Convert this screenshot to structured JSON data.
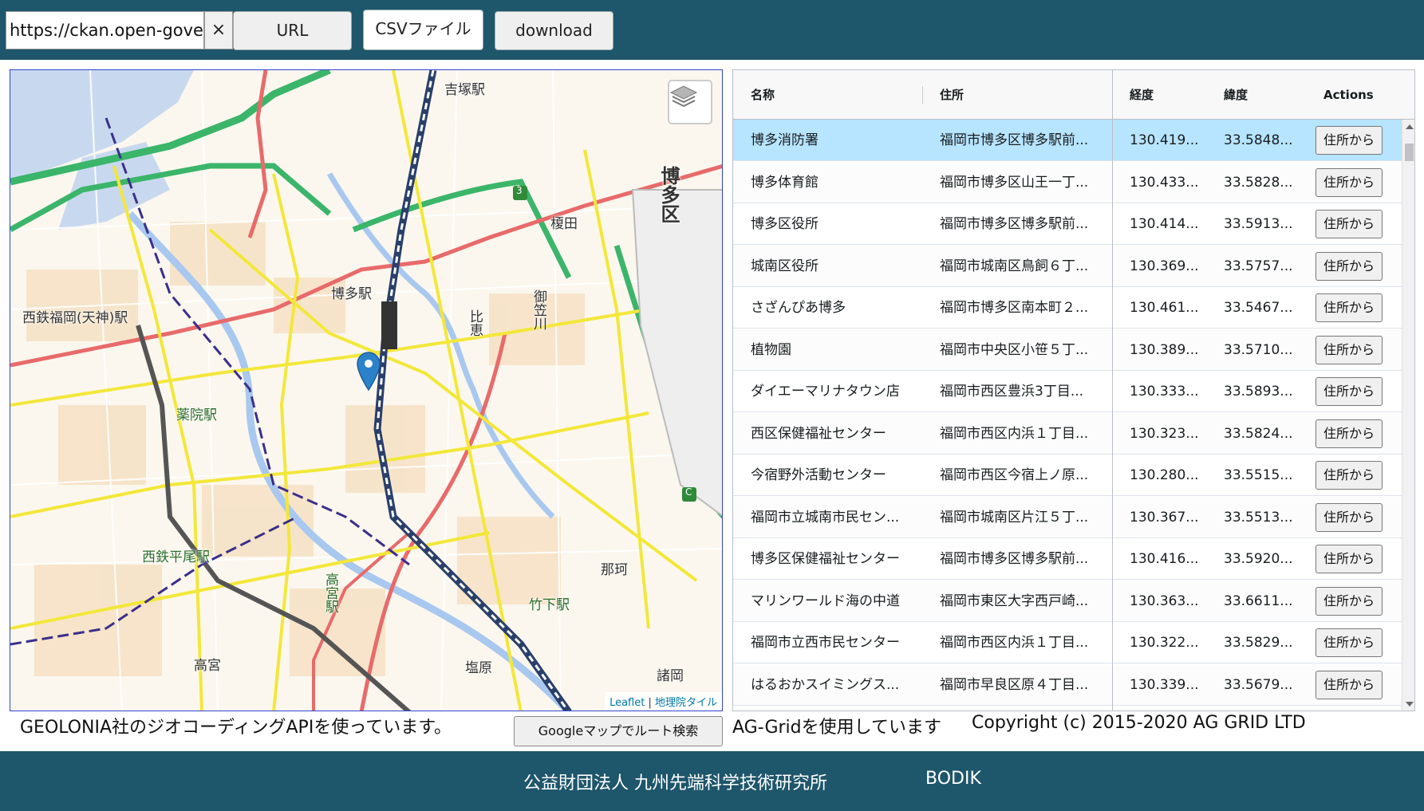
{
  "toolbar": {
    "url_value": "https://ckan.open-governme",
    "clear_label": "×",
    "url_button": "URL",
    "csv_button": "CSVファイル",
    "download_button": "download"
  },
  "map": {
    "labels": {
      "yoshizuka": "吉塚駅",
      "hakata_ku": "博多区",
      "enokida": "榎田",
      "hakata_eki": "博多駅",
      "nishitetsu_fukuoka": "西鉄福岡(天神)駅",
      "hie": "比恵",
      "mikasagawa": "御笠川",
      "yakuin": "薬院駅",
      "nishitetsu_hirao": "西鉄平尾駅",
      "naka": "那珂",
      "takeshita": "竹下駅",
      "takamiya_eki": "高宮駅",
      "takamiya": "高宮",
      "shiobaru": "塩原",
      "morooka": "諸岡",
      "route3": "3",
      "routeC": "C"
    },
    "layers_icon": "layers-icon",
    "marker_icon": "map-marker-icon",
    "attribution_leaflet": "Leaflet",
    "attribution_sep": " | ",
    "attribution_tiles": "地理院タイル"
  },
  "geo_note": "GEOLONIA社のジオコーディングAPIを使っています。",
  "route_button": "Googleマップでルート検索",
  "grid": {
    "headers": {
      "name": "名称",
      "address": "住所",
      "lng": "経度",
      "lat": "緯度",
      "actions": "Actions"
    },
    "action_label": "住所から",
    "rows": [
      {
        "name": "博多消防署",
        "address": "福岡市博多区博多駅前...",
        "lng": "130.419...",
        "lat": "33.5848..."
      },
      {
        "name": "博多体育館",
        "address": "福岡市博多区山王一丁...",
        "lng": "130.433...",
        "lat": "33.5828..."
      },
      {
        "name": "博多区役所",
        "address": "福岡市博多区博多駅前...",
        "lng": "130.414...",
        "lat": "33.5913..."
      },
      {
        "name": "城南区役所",
        "address": "福岡市城南区鳥飼６丁...",
        "lng": "130.369...",
        "lat": "33.5757..."
      },
      {
        "name": "さざんぴあ博多",
        "address": "福岡市博多区南本町２...",
        "lng": "130.461...",
        "lat": "33.5467..."
      },
      {
        "name": "植物園",
        "address": "福岡市中央区小笹５丁...",
        "lng": "130.389...",
        "lat": "33.5710..."
      },
      {
        "name": "ダイエーマリナタウン店",
        "address": "福岡市西区豊浜3丁目...",
        "lng": "130.333...",
        "lat": "33.5893..."
      },
      {
        "name": "西区保健福祉センター",
        "address": "福岡市西区内浜１丁目...",
        "lng": "130.323...",
        "lat": "33.5824..."
      },
      {
        "name": "今宿野外活動センター",
        "address": "福岡市西区今宿上ノ原...",
        "lng": "130.280...",
        "lat": "33.5515..."
      },
      {
        "name": "福岡市立城南市民セン...",
        "address": "福岡市城南区片江５丁...",
        "lng": "130.367...",
        "lat": "33.5513..."
      },
      {
        "name": "博多区保健福祉センター",
        "address": "福岡市博多区博多駅前...",
        "lng": "130.416...",
        "lat": "33.5920..."
      },
      {
        "name": "マリンワールド海の中道",
        "address": "福岡市東区大字西戸崎...",
        "lng": "130.363...",
        "lat": "33.6611..."
      },
      {
        "name": "福岡市立西市民センター",
        "address": "福岡市西区内浜１丁目...",
        "lng": "130.322...",
        "lat": "33.5829..."
      },
      {
        "name": "はるおかスイミングス...",
        "address": "福岡市早良区原４丁目...",
        "lng": "130.339...",
        "lat": "33.5679..."
      }
    ]
  },
  "aggrid_note": "AG-Gridを使用しています",
  "copyright": "Copyright (c) 2015-2020 AG GRID LTD",
  "footer": {
    "org": "公益財団法人 九州先端科学技術研究所",
    "bodik": "BODIK"
  },
  "colors": {
    "header_bg": "#1e566b",
    "selected_row": "#b7e4ff"
  }
}
